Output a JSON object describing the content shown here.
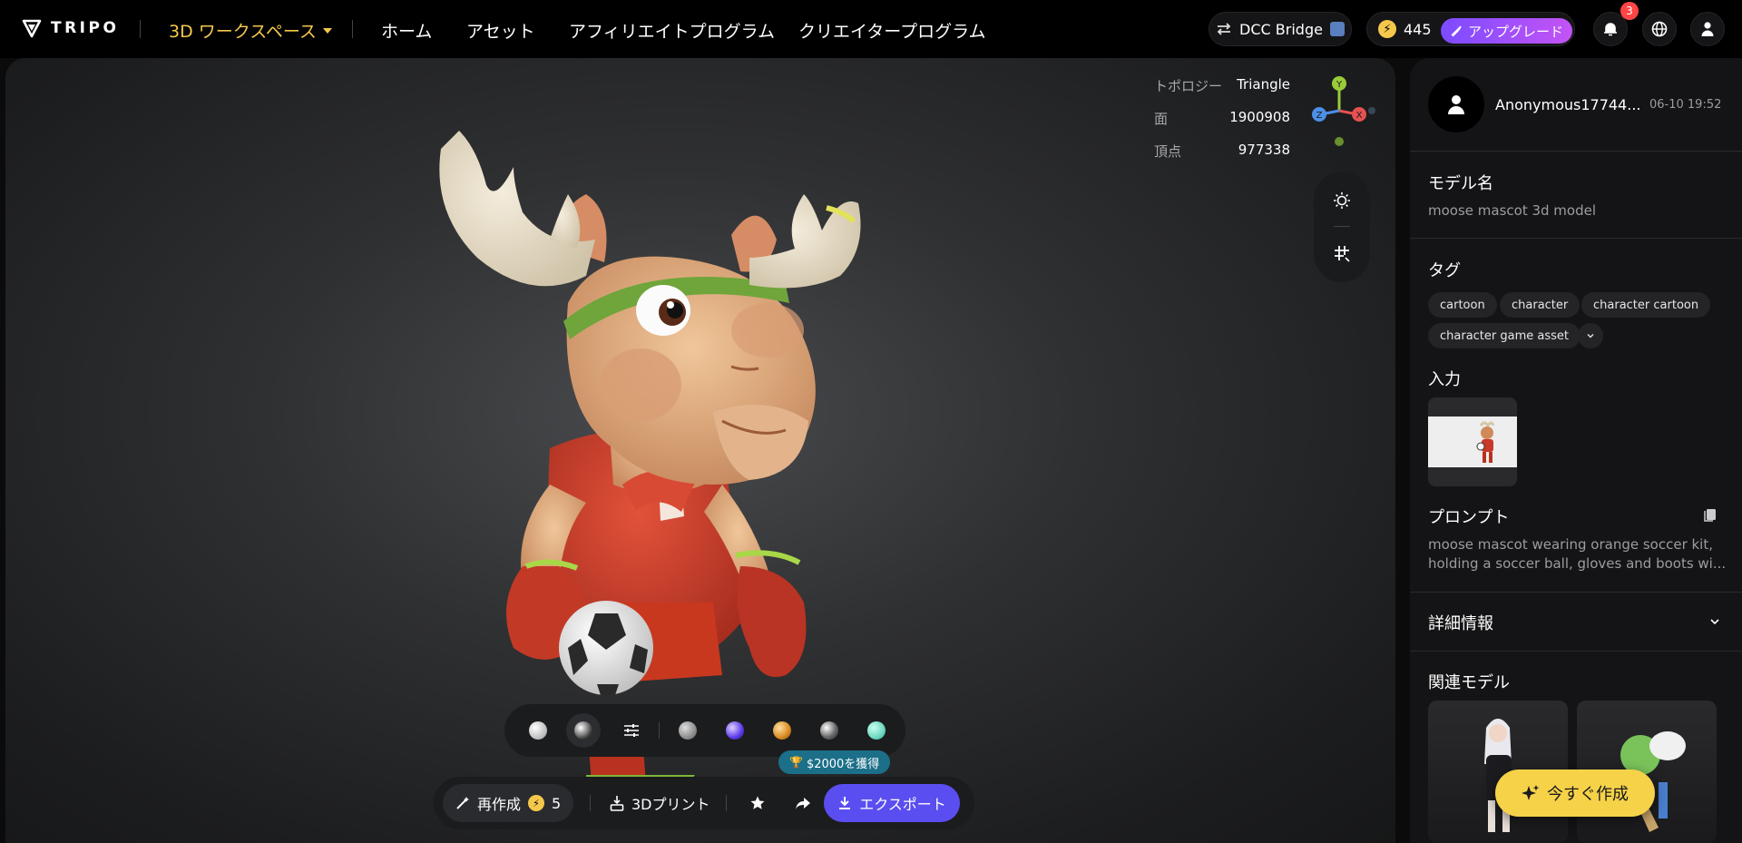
{
  "brand": {
    "name": "TRIPO"
  },
  "nav": {
    "workspace": "3D ワークスペース",
    "items": [
      "ホーム",
      "アセット",
      "アフィリエイトプログラム",
      "クリエイタープログラム"
    ]
  },
  "header": {
    "dcc_label": "DCC Bridge",
    "credits": "445",
    "upgrade_label": "アップグレード",
    "notifications_count": "3"
  },
  "stats": {
    "topology_label": "トポロジー",
    "topology_value": "Triangle",
    "faces_label": "面",
    "faces_value": "1900908",
    "vertices_label": "頂点",
    "vertices_value": "977338"
  },
  "axes": {
    "x": "X",
    "y": "Y",
    "z": "Z"
  },
  "toolbar": {
    "regenerate_label": "再作成",
    "regenerate_cost": "5",
    "print_label": "3Dプリント",
    "export_label": "エクスポート",
    "earn_label": "$2000を獲得"
  },
  "panel": {
    "username": "Anonymous17744...",
    "timestamp": "06-10 19:52",
    "model_name_label": "モデル名",
    "model_name": "moose mascot 3d model",
    "tags_label": "タグ",
    "tags": [
      "cartoon",
      "character",
      "character cartoon",
      "character game asset"
    ],
    "input_label": "入力",
    "prompt_label": "プロンプト",
    "prompt_line1": "moose mascot wearing orange soccer kit,",
    "prompt_line2": "holding a soccer ball, gloves and boots wi...",
    "details_label": "詳細情報",
    "related_label": "関連モデル",
    "create_now_label": "今すぐ作成"
  },
  "colors": {
    "accent_yellow": "#f6d249",
    "export_purple": "#5b4ef0",
    "upgrade_gradient_start": "#7b4cff"
  }
}
